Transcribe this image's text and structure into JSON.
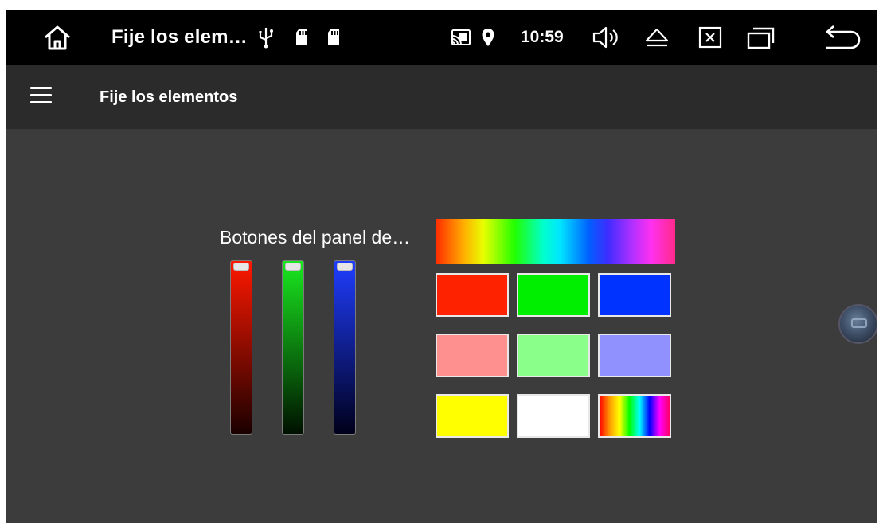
{
  "statusbar": {
    "title": "Fije los elem…",
    "time": "10:59",
    "icons": [
      "home-icon",
      "usb-icon",
      "sd-card-icon",
      "sd-card-icon",
      "cast-icon",
      "location-icon",
      "volume-icon",
      "eject-icon",
      "close-box-icon",
      "recent-apps-icon",
      "back-icon"
    ]
  },
  "appbar": {
    "title": "Fije los elementos",
    "menu_icon": "hamburger-menu-icon"
  },
  "panel": {
    "label": "Botones del panel de…",
    "sliders": [
      {
        "name": "red",
        "color": "#ff1800",
        "level": 1.0
      },
      {
        "name": "green",
        "color": "#19e81f",
        "level": 1.0
      },
      {
        "name": "blue",
        "color": "#1f3dff",
        "level": 1.0
      }
    ],
    "presets": [
      "#ff2200",
      "#00ee00",
      "#0033ff",
      "#ff9090",
      "#8aff8a",
      "#9090ff",
      "#ffff00",
      "#ffffff",
      "rainbow"
    ]
  }
}
